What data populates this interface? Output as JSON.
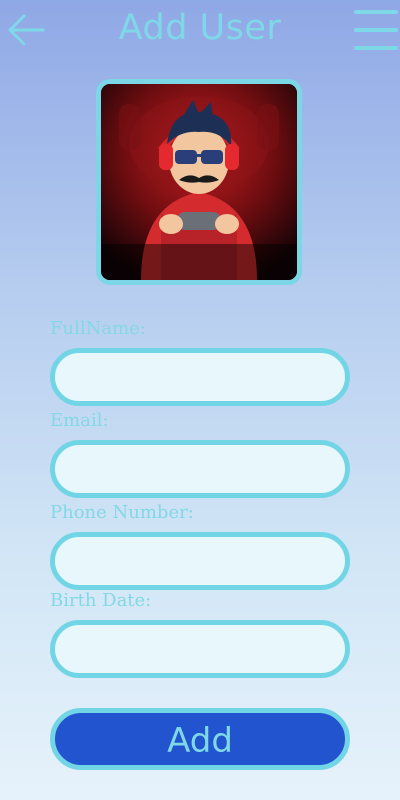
{
  "header": {
    "title": "Add User",
    "back_icon": "arrow-left-icon",
    "menu_icon": "hamburger-menu-icon"
  },
  "avatar": {
    "description_icon": "gamer-avatar-image"
  },
  "form": {
    "fields": [
      {
        "label": "FullName:",
        "value": "",
        "placeholder": ""
      },
      {
        "label": "Email:",
        "value": "",
        "placeholder": ""
      },
      {
        "label": "Phone Number:",
        "value": "",
        "placeholder": ""
      },
      {
        "label": "Birth Date:",
        "value": "",
        "placeholder": ""
      }
    ],
    "submit_label": "Add"
  },
  "colors": {
    "accent": "#7fd8e7",
    "button_bg": "#2254cf",
    "input_bg": "#e8f7fb"
  }
}
